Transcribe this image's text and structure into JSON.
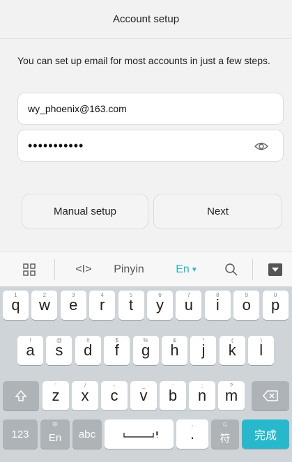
{
  "header": {
    "title": "Account setup"
  },
  "intro_text": "You can set up email for most accounts in just a few steps.",
  "email_field": {
    "value": "wy_phoenix@163.com"
  },
  "password_field": {
    "value": "•••••••••••"
  },
  "buttons": {
    "manual": "Manual setup",
    "next": "Next"
  },
  "ime_bar": {
    "cursor_label": "<I>",
    "pinyin": "Pinyin",
    "en": "En",
    "accent": "#27b9c9",
    "icons": [
      "grid-icon",
      "cursor-icon",
      "search-icon",
      "hide-keyboard-icon"
    ]
  },
  "keyboard": {
    "row1": [
      {
        "k": "q",
        "n": "1"
      },
      {
        "k": "w",
        "n": "2"
      },
      {
        "k": "e",
        "n": "3"
      },
      {
        "k": "r",
        "n": "4"
      },
      {
        "k": "t",
        "n": "5"
      },
      {
        "k": "y",
        "n": "6"
      },
      {
        "k": "u",
        "n": "7"
      },
      {
        "k": "i",
        "n": "8"
      },
      {
        "k": "o",
        "n": "9"
      },
      {
        "k": "p",
        "n": "0"
      }
    ],
    "row2": [
      {
        "k": "a",
        "n": "!"
      },
      {
        "k": "s",
        "n": "@"
      },
      {
        "k": "d",
        "n": "#"
      },
      {
        "k": "f",
        "n": "$"
      },
      {
        "k": "g",
        "n": "%"
      },
      {
        "k": "h",
        "n": "&"
      },
      {
        "k": "j",
        "n": "*"
      },
      {
        "k": "k",
        "n": "("
      },
      {
        "k": "l",
        "n": ")"
      }
    ],
    "row3": [
      {
        "k": "z",
        "n": "'"
      },
      {
        "k": "x",
        "n": "/"
      },
      {
        "k": "c",
        "n": "-"
      },
      {
        "k": "v",
        "n": "_"
      },
      {
        "k": "b",
        "n": ":"
      },
      {
        "k": "n",
        "n": ";"
      },
      {
        "k": "m",
        "n": "?"
      }
    ],
    "bottom": {
      "num": "123",
      "lang": "En",
      "lang_top": "中",
      "abc": "abc",
      "comma": ",",
      "period": ".",
      "emoji_top": "☺",
      "symbol": "符",
      "done": "完成"
    }
  }
}
